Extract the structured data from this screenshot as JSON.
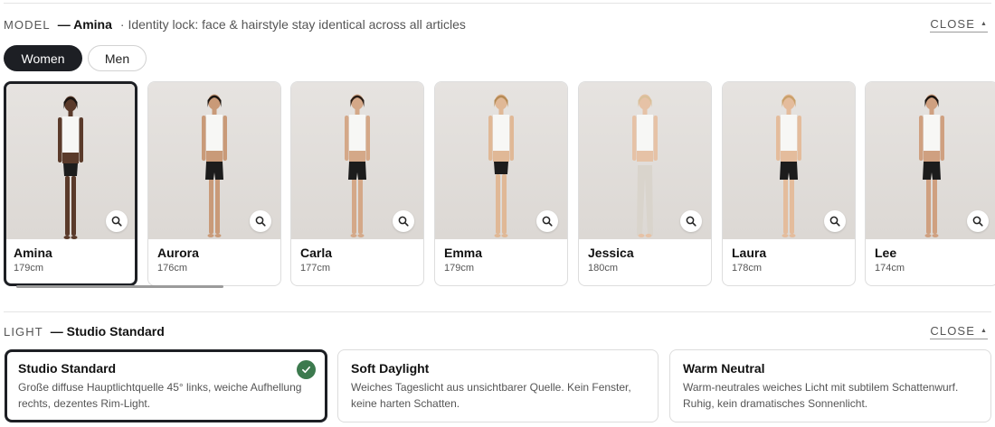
{
  "model_section": {
    "key": "MODEL",
    "selected_label": "— Amina",
    "description": "· Identity lock: face & hairstyle stay identical across all articles",
    "close_label": "CLOSE",
    "gender_tabs": [
      {
        "label": "Women",
        "active": true
      },
      {
        "label": "Men",
        "active": false
      }
    ],
    "models": [
      {
        "name": "Amina",
        "height": "179cm",
        "selected": true,
        "skin": "#5a3a2a",
        "hair": "#1a1410",
        "bottom": "#1c1c1c",
        "bottom_style": "briefs"
      },
      {
        "name": "Aurora",
        "height": "176cm",
        "selected": false,
        "skin": "#c99a78",
        "hair": "#1c1612",
        "bottom": "#1c1c1c",
        "bottom_style": "shorts"
      },
      {
        "name": "Carla",
        "height": "177cm",
        "selected": false,
        "skin": "#d4a888",
        "hair": "#2a1d15",
        "bottom": "#1c1c1c",
        "bottom_style": "shorts"
      },
      {
        "name": "Emma",
        "height": "179cm",
        "selected": false,
        "skin": "#e0b896",
        "hair": "#b58a55",
        "bottom": "#1c1c1c",
        "bottom_style": "briefs"
      },
      {
        "name": "Jessica",
        "height": "180cm",
        "selected": false,
        "skin": "#e6c2a6",
        "hair": "#d9c09a",
        "bottom": "#d9d4cc",
        "bottom_style": "trousers"
      },
      {
        "name": "Laura",
        "height": "178cm",
        "selected": false,
        "skin": "#e4bc9c",
        "hair": "#c9a06a",
        "bottom": "#1c1c1c",
        "bottom_style": "shorts"
      },
      {
        "name": "Lee",
        "height": "174cm",
        "selected": false,
        "skin": "#cfa080",
        "hair": "#1a1410",
        "bottom": "#1c1c1c",
        "bottom_style": "shorts"
      }
    ]
  },
  "light_section": {
    "key": "LIGHT",
    "selected_label": "— Studio Standard",
    "close_label": "CLOSE",
    "options": [
      {
        "title": "Studio Standard",
        "desc_line1": "Große diffuse Hauptlichtquelle 45° links, weiche Aufhellung",
        "desc_line2": "rechts, dezentes Rim-Light.",
        "selected": true
      },
      {
        "title": "Soft Daylight",
        "desc_line1": "Weiches Tageslicht aus unsichtbarer Quelle. Kein Fenster,",
        "desc_line2": "keine harten Schatten.",
        "selected": false
      },
      {
        "title": "Warm Neutral",
        "desc_line1": "Warm-neutrales weiches Licht mit subtilem Schattenwurf.",
        "desc_line2": "Ruhig, kein dramatisches Sonnenlicht.",
        "selected": false
      }
    ]
  },
  "colors": {
    "accent_dark": "#1d1f24",
    "check_green": "#3c7a4e"
  }
}
